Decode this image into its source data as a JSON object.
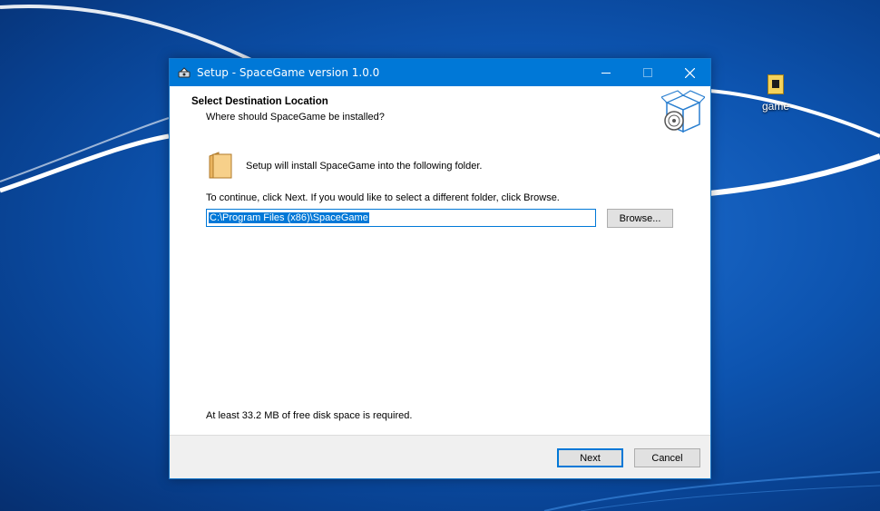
{
  "desktop": {
    "icon_label": "game"
  },
  "window": {
    "title": "Setup - SpaceGame version 1.0.0"
  },
  "header": {
    "title": "Select Destination Location",
    "subtitle": "Where should SpaceGame be installed?"
  },
  "body": {
    "intro": "Setup will install SpaceGame into the following folder.",
    "instruction": "To continue, click Next. If you would like to select a different folder, click Browse.",
    "install_path": "C:\\Program Files (x86)\\SpaceGame",
    "browse_label": "Browse...",
    "disk_space": "At least 33.2 MB of free disk space is required."
  },
  "footer": {
    "next_label": "Next",
    "cancel_label": "Cancel"
  },
  "colors": {
    "titlebar": "#0078d7",
    "accent": "#0078d7",
    "footer_bg": "#f0f0f0"
  },
  "icons": [
    "app-icon",
    "minimize-icon",
    "maximize-icon",
    "close-icon",
    "setup-box-icon",
    "folder-icon",
    "desktop-file-icon"
  ]
}
